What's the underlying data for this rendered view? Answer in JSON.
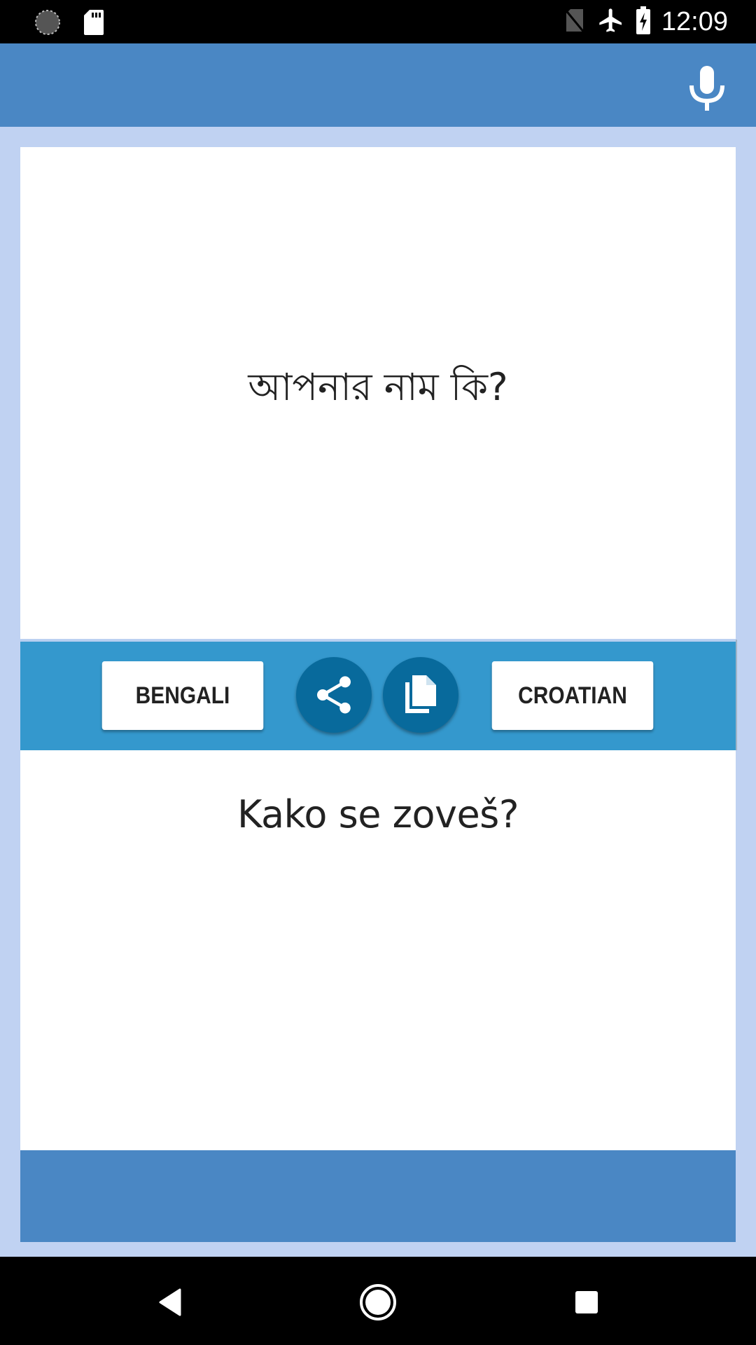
{
  "status_bar": {
    "time": "12:09",
    "icons_left": [
      "sync-icon",
      "sd-card-icon"
    ],
    "icons_right": [
      "no-sim-icon",
      "airplane-mode-icon",
      "battery-charging-icon"
    ]
  },
  "app_bar": {
    "mic_icon": "microphone-icon"
  },
  "source": {
    "text": "আপনার নাম কি?"
  },
  "toolbar": {
    "source_language": "BENGALI",
    "target_language": "CROATIAN",
    "share_icon": "share-icon",
    "copy_icon": "copy-icon"
  },
  "target": {
    "text": "Kako se zoveš?"
  },
  "colors": {
    "primary": "#4a87c4",
    "background": "#c0d2f2",
    "toolbar": "#3498cd",
    "round_button": "#086a9c"
  },
  "nav_bar": {
    "back": "back-icon",
    "home": "home-icon",
    "recents": "recents-icon"
  }
}
